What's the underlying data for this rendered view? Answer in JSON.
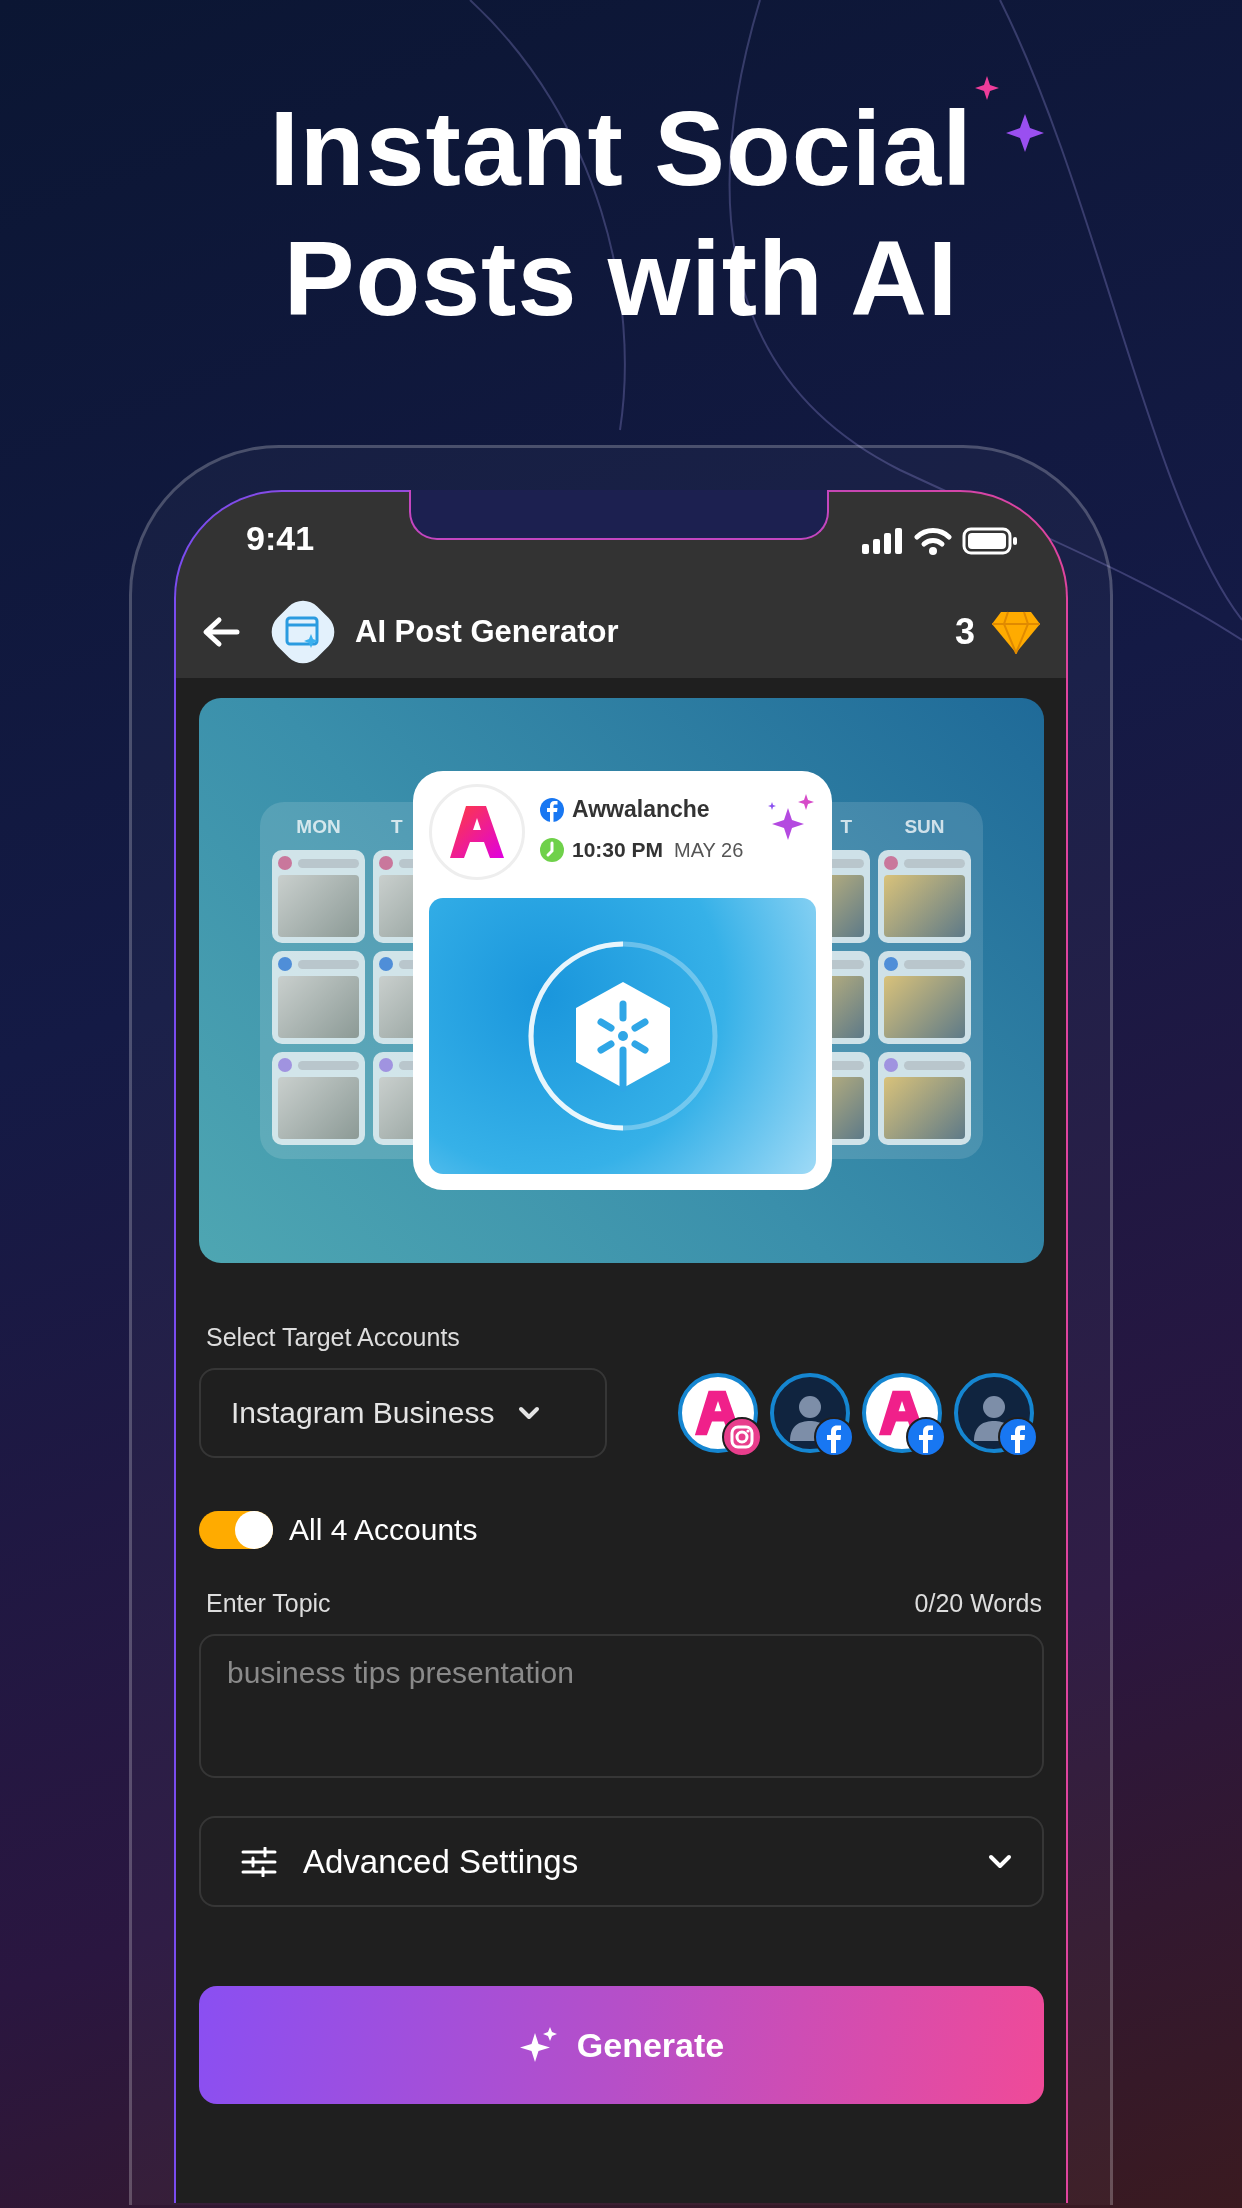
{
  "headline": {
    "lines": [
      "Instant Social",
      "Posts with AI"
    ]
  },
  "status_bar": {
    "time": "9:41"
  },
  "header": {
    "title": "AI Post Generator",
    "credits": "3"
  },
  "preview": {
    "days": [
      "MON",
      "T",
      "T",
      "SUN"
    ],
    "post": {
      "account": "Awwalanche",
      "time": "10:30 PM",
      "date": "MAY 26"
    }
  },
  "accounts": {
    "label": "Select Target Accounts",
    "dropdown": "Instagram Business",
    "avatars": [
      {
        "kind": "brand",
        "badge": {
          "kind": "instagram"
        }
      },
      {
        "kind": "person",
        "badge": {
          "kind": "facebook"
        }
      },
      {
        "kind": "brand",
        "badge": {
          "kind": "facebook"
        }
      },
      {
        "kind": "person",
        "badge": {
          "kind": "facebook"
        }
      }
    ]
  },
  "all_accounts": {
    "label": "All 4 Accounts",
    "on": true
  },
  "topic": {
    "label": "Enter Topic",
    "counter": "0/20 Words",
    "placeholder": "business tips presentation"
  },
  "advanced_settings": {
    "label": "Advanced Settings",
    "expanded": false
  },
  "generate_button": {
    "label": "Generate"
  }
}
